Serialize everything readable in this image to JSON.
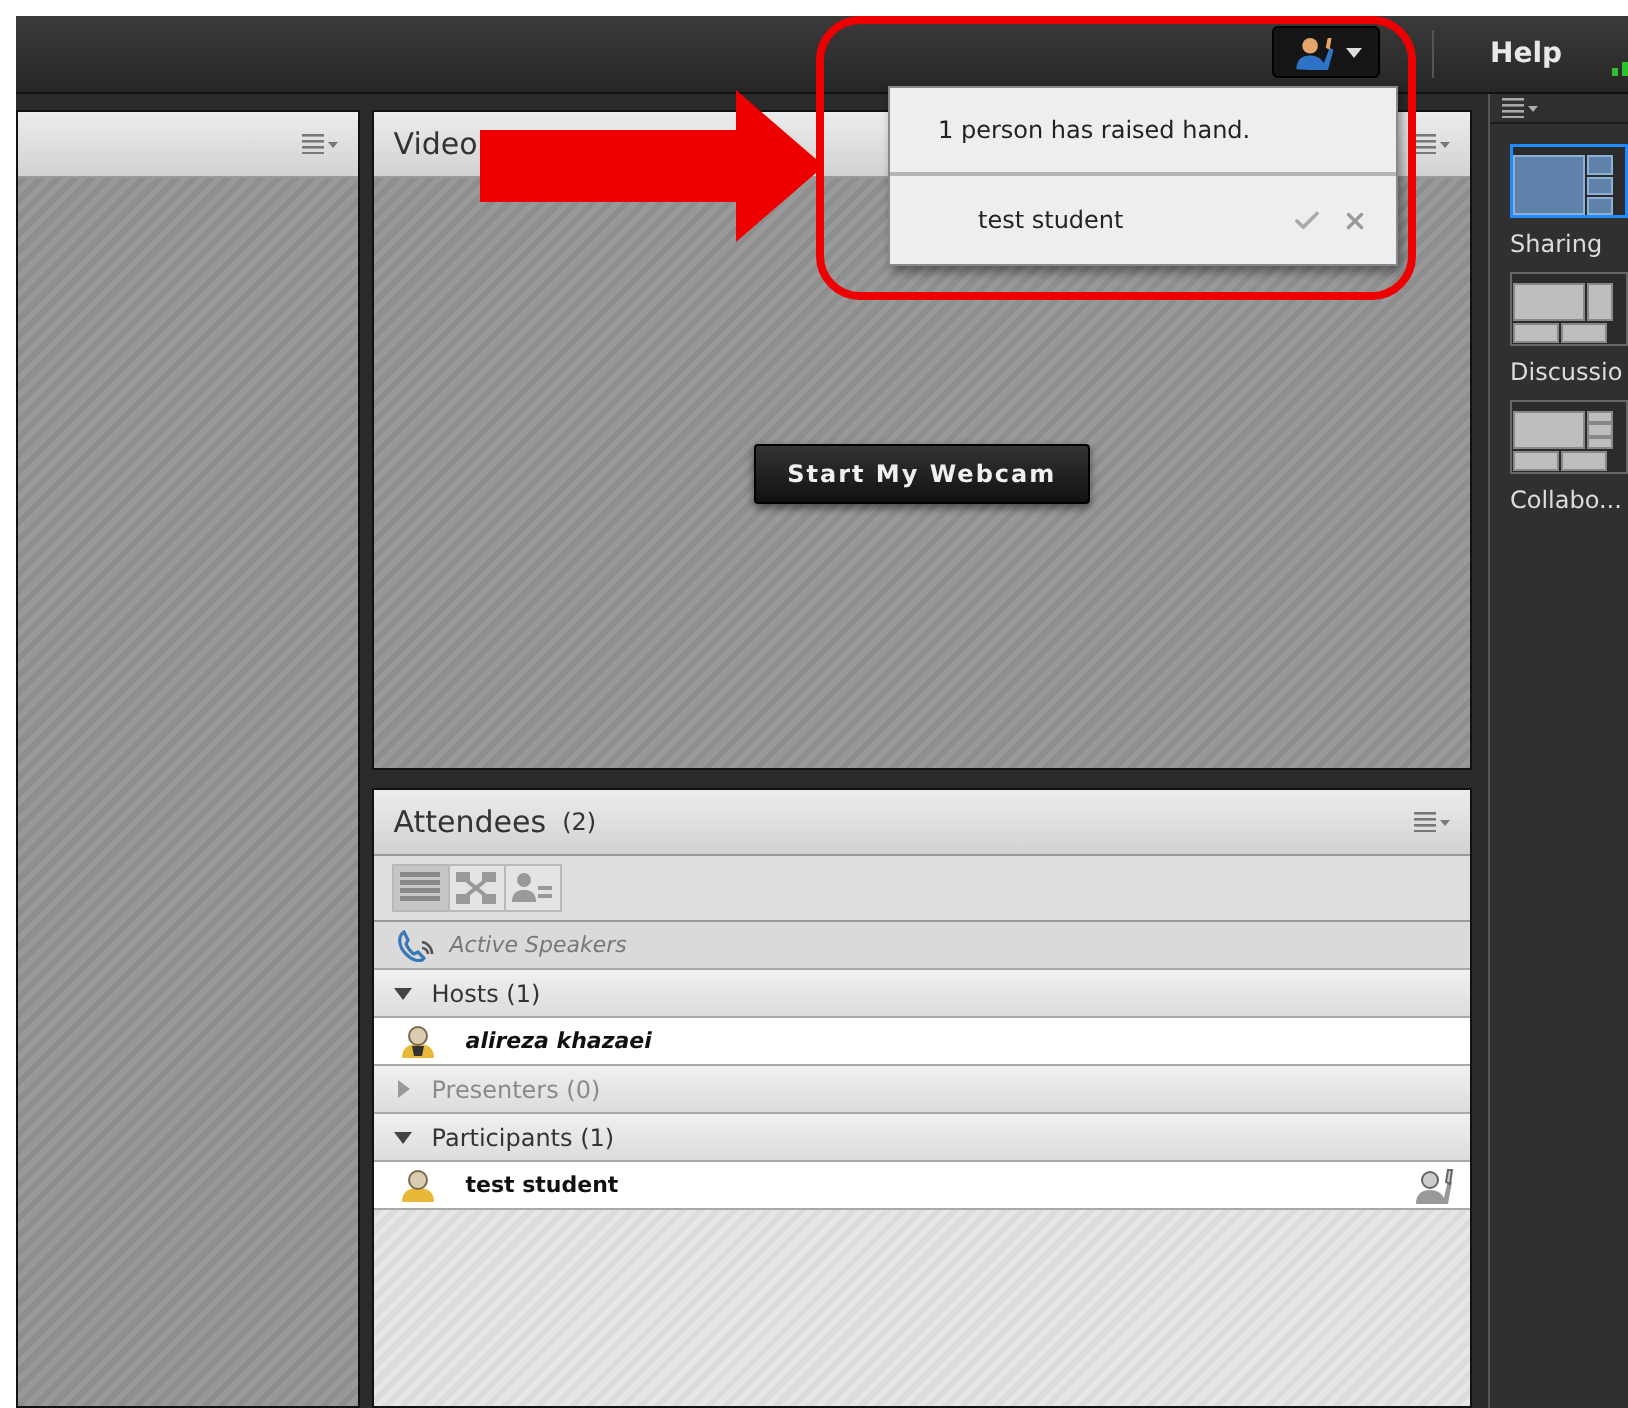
{
  "top_bar": {
    "help": "Help"
  },
  "raised_hands_menu": {
    "message": "1 person has raised hand.",
    "people": [
      {
        "name": "test student"
      }
    ]
  },
  "video_pod": {
    "title": "Video",
    "button": "Start My Webcam"
  },
  "attendees_pod": {
    "title": "Attendees",
    "count": "(2)",
    "views": [
      {
        "kind": "list",
        "selected": true
      },
      {
        "kind": "breakout",
        "selected": false
      },
      {
        "kind": "status",
        "selected": false
      }
    ],
    "active_speakers": "Active Speakers",
    "groups": [
      {
        "label": "Hosts (1)",
        "expanded": true,
        "members": [
          {
            "name": "alireza khazaei",
            "kind": "host",
            "hand_raised": false
          }
        ]
      },
      {
        "label": "Presenters (0)",
        "expanded": false
      },
      {
        "label": "Participants (1)",
        "expanded": true,
        "members": [
          {
            "name": "test student",
            "kind": "participant",
            "hand_raised": true
          }
        ]
      }
    ]
  },
  "layouts": [
    {
      "label": "Sharing",
      "kind": "sharing",
      "selected": true
    },
    {
      "label": "Discussio",
      "kind": "discussion",
      "selected": false
    },
    {
      "label": "Collabo...",
      "kind": "collaboration",
      "selected": false
    }
  ]
}
